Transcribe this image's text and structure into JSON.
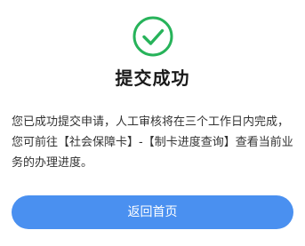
{
  "result": {
    "icon": "check-circle-icon",
    "icon_color": "#27b35a",
    "title": "提交成功",
    "message": "您已成功提交申请，人工审核将在三个工作日内完成，您可前往【社会保障卡】-【制卡进度查询】查看当前业务的办理进度。"
  },
  "actions": {
    "back_home_label": "返回首页",
    "button_color": "#4a90f0"
  }
}
